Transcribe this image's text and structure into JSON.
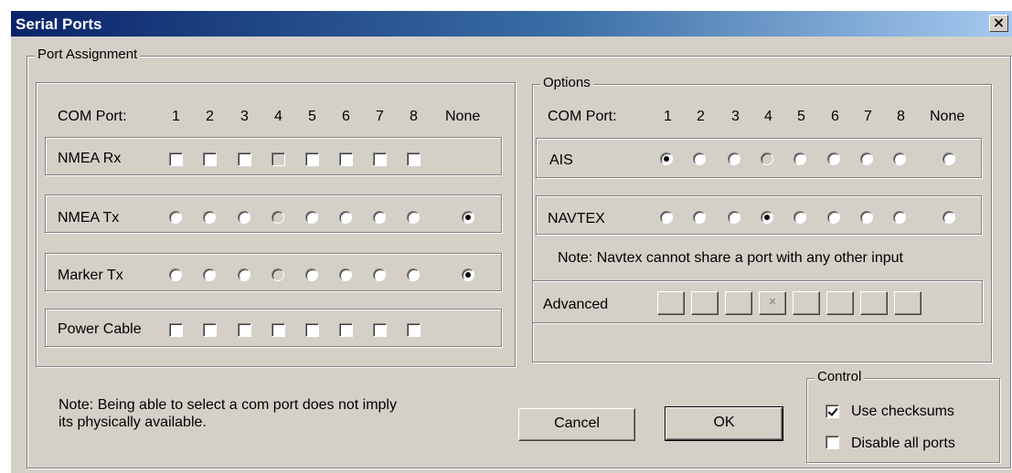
{
  "window": {
    "title": "Serial Ports",
    "close_label": "×"
  },
  "port_assignment": {
    "legend": "Port Assignment",
    "com_port_label": "COM Port:",
    "port_numbers": [
      "1",
      "2",
      "3",
      "4",
      "5",
      "6",
      "7",
      "8"
    ],
    "none_label": "None",
    "nmea_rx": {
      "label": "NMEA Rx",
      "checked": [
        false,
        false,
        false,
        false,
        false,
        false,
        false,
        false
      ],
      "disabled": [
        false,
        false,
        false,
        true,
        false,
        false,
        false,
        false
      ]
    },
    "nmea_tx": {
      "label": "NMEA Tx",
      "selected": "None",
      "disabled": [
        false,
        false,
        false,
        true,
        false,
        false,
        false,
        false
      ]
    },
    "marker_tx": {
      "label": "Marker Tx",
      "selected": "None",
      "disabled": [
        false,
        false,
        false,
        true,
        false,
        false,
        false,
        false
      ]
    },
    "power_cable": {
      "label": "Power Cable",
      "checked": [
        false,
        false,
        false,
        false,
        false,
        false,
        false,
        false
      ]
    },
    "note": "Note: Being able to select a com port does not imply its physically available."
  },
  "options": {
    "legend": "Options",
    "com_port_label": "COM Port:",
    "port_numbers": [
      "1",
      "2",
      "3",
      "4",
      "5",
      "6",
      "7",
      "8"
    ],
    "none_label": "None",
    "ais": {
      "label": "AIS",
      "selected": "1",
      "disabled": [
        false,
        false,
        false,
        true,
        false,
        false,
        false,
        false
      ]
    },
    "navtex": {
      "label": "NAVTEX",
      "selected": "4",
      "disabled": [
        false,
        false,
        false,
        false,
        false,
        false,
        false,
        false
      ]
    },
    "navtex_note": "Note: Navtex cannot share a port with any other input",
    "advanced": {
      "label": "Advanced",
      "buttons": [
        "",
        "",
        "",
        "×",
        "",
        "",
        "",
        ""
      ]
    }
  },
  "buttons": {
    "cancel": "Cancel",
    "ok": "OK"
  },
  "control": {
    "legend": "Control",
    "use_checksums": {
      "label": "Use checksums",
      "checked": true
    },
    "disable_all_ports": {
      "label": "Disable all ports",
      "checked": false
    }
  }
}
